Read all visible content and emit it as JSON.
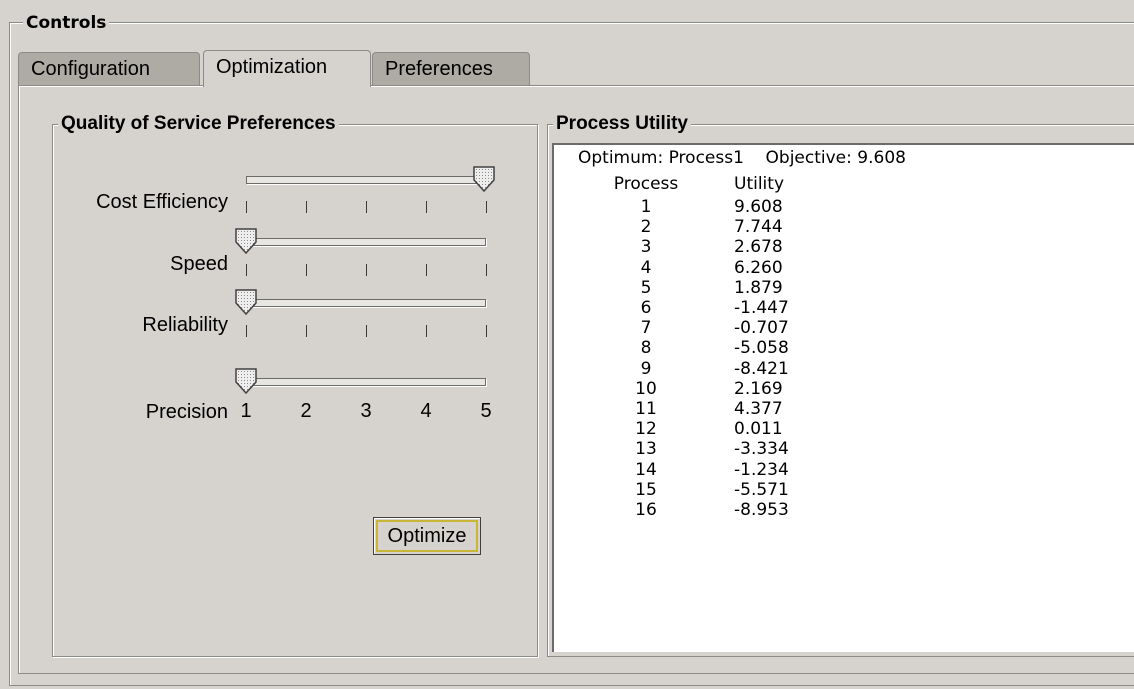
{
  "controls_title": "Controls",
  "tabs": [
    {
      "label": "Configuration",
      "active": false
    },
    {
      "label": "Optimization",
      "active": true
    },
    {
      "label": "Preferences",
      "active": false
    }
  ],
  "qos": {
    "title": "Quality of Service Preferences",
    "sliders": [
      {
        "label": "Cost Efficiency",
        "value": 5
      },
      {
        "label": "Speed",
        "value": 1
      },
      {
        "label": "Reliability",
        "value": 1
      },
      {
        "label": "Precision",
        "value": 1
      }
    ],
    "scale_labels": [
      "1",
      "2",
      "3",
      "4",
      "5"
    ],
    "optimize_label": "Optimize"
  },
  "process_utility": {
    "title": "Process Utility",
    "optimum_label": "Optimum:",
    "optimum_value": "Process1",
    "objective_label": "Objective:",
    "objective_value": "9.608",
    "col_process": "Process",
    "col_utility": "Utility",
    "rows": [
      {
        "process": "1",
        "utility": "9.608"
      },
      {
        "process": "2",
        "utility": "7.744"
      },
      {
        "process": "3",
        "utility": "2.678"
      },
      {
        "process": "4",
        "utility": "6.260"
      },
      {
        "process": "5",
        "utility": "1.879"
      },
      {
        "process": "6",
        "utility": "-1.447"
      },
      {
        "process": "7",
        "utility": "-0.707"
      },
      {
        "process": "8",
        "utility": "-5.058"
      },
      {
        "process": "9",
        "utility": "-8.421"
      },
      {
        "process": "10",
        "utility": "2.169"
      },
      {
        "process": "11",
        "utility": "4.377"
      },
      {
        "process": "12",
        "utility": "0.011"
      },
      {
        "process": "13",
        "utility": "-3.334"
      },
      {
        "process": "14",
        "utility": "-1.234"
      },
      {
        "process": "15",
        "utility": "-5.571"
      },
      {
        "process": "16",
        "utility": "-8.953"
      }
    ]
  }
}
